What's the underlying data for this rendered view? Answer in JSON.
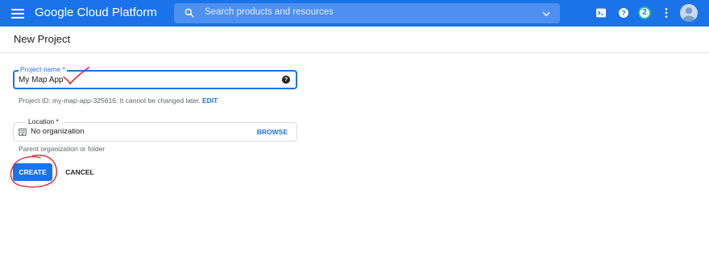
{
  "topbar": {
    "brand": "Google Cloud Platform",
    "search_placeholder": "Search products and resources",
    "notification_count": "2",
    "menu_icon": "hamburger-menu-icon",
    "search_icon": "search-icon",
    "chevron_icon": "chevron-down-icon",
    "cloud_shell_icon": "terminal-icon",
    "help_icon": "help-icon",
    "more_icon": "more-vert-icon",
    "avatar_icon": "account-avatar-icon",
    "color": "#1a73e8"
  },
  "page": {
    "title": "New Project"
  },
  "form": {
    "project_name_label": "Project name *",
    "project_name_value": "My Map App",
    "project_id_text": "Project ID: my-map-app-325616. It cannot be changed later.",
    "edit_label": "EDIT",
    "location_label": "Location *",
    "location_value": "No organization",
    "browse_label": "BROWSE",
    "location_helper": "Parent organization or folder",
    "create_label": "CREATE",
    "cancel_label": "CANCEL"
  },
  "annotations": {
    "color": "#e0242c",
    "marks": [
      "checkmark-annotation",
      "circle-annotation"
    ]
  }
}
